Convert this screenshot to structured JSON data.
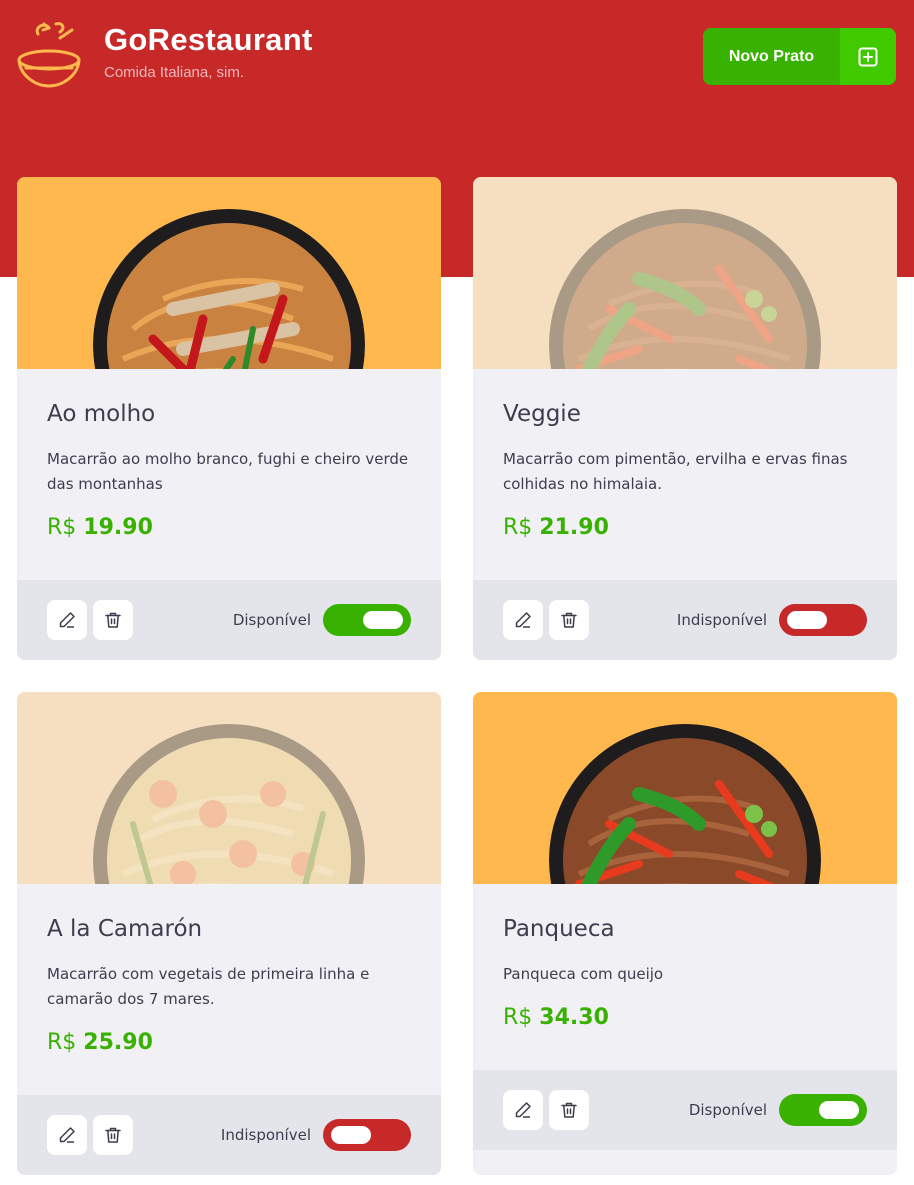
{
  "header": {
    "brand_title": "GoRestaurant",
    "brand_subtitle": "Comida Italiana, sim.",
    "new_dish_label": "Novo Prato",
    "logo_icon": "bowl-icon",
    "new_dish_icon": "plus-square-icon"
  },
  "colors": {
    "header_bg": "#C72828",
    "accent_green": "#39B100",
    "unavailable_red": "#C72828",
    "card_bg": "#F0F0F5",
    "card_footer_bg": "#E4E4EB"
  },
  "dishes": [
    {
      "name": "Ao molho",
      "description": "Macarrão ao molho branco, fughi e cheiro verde das montanhas",
      "currency": "R$",
      "price": "19.90",
      "status_label": "Disponível",
      "available": true
    },
    {
      "name": "Veggie",
      "description": "Macarrão com pimentão, ervilha e ervas finas colhidas no himalaia.",
      "currency": "R$",
      "price": "21.90",
      "status_label": "Indisponível",
      "available": false
    },
    {
      "name": "A la Camarón",
      "description": "Macarrão com vegetais de primeira linha e camarão dos 7 mares.",
      "currency": "R$",
      "price": "25.90",
      "status_label": "Indisponível",
      "available": false
    },
    {
      "name": "Panqueca",
      "description": "Panqueca com queijo",
      "currency": "R$",
      "price": "34.30",
      "status_label": "Disponível",
      "available": true
    }
  ],
  "actions": {
    "edit_icon": "pencil-icon",
    "delete_icon": "trash-icon"
  }
}
